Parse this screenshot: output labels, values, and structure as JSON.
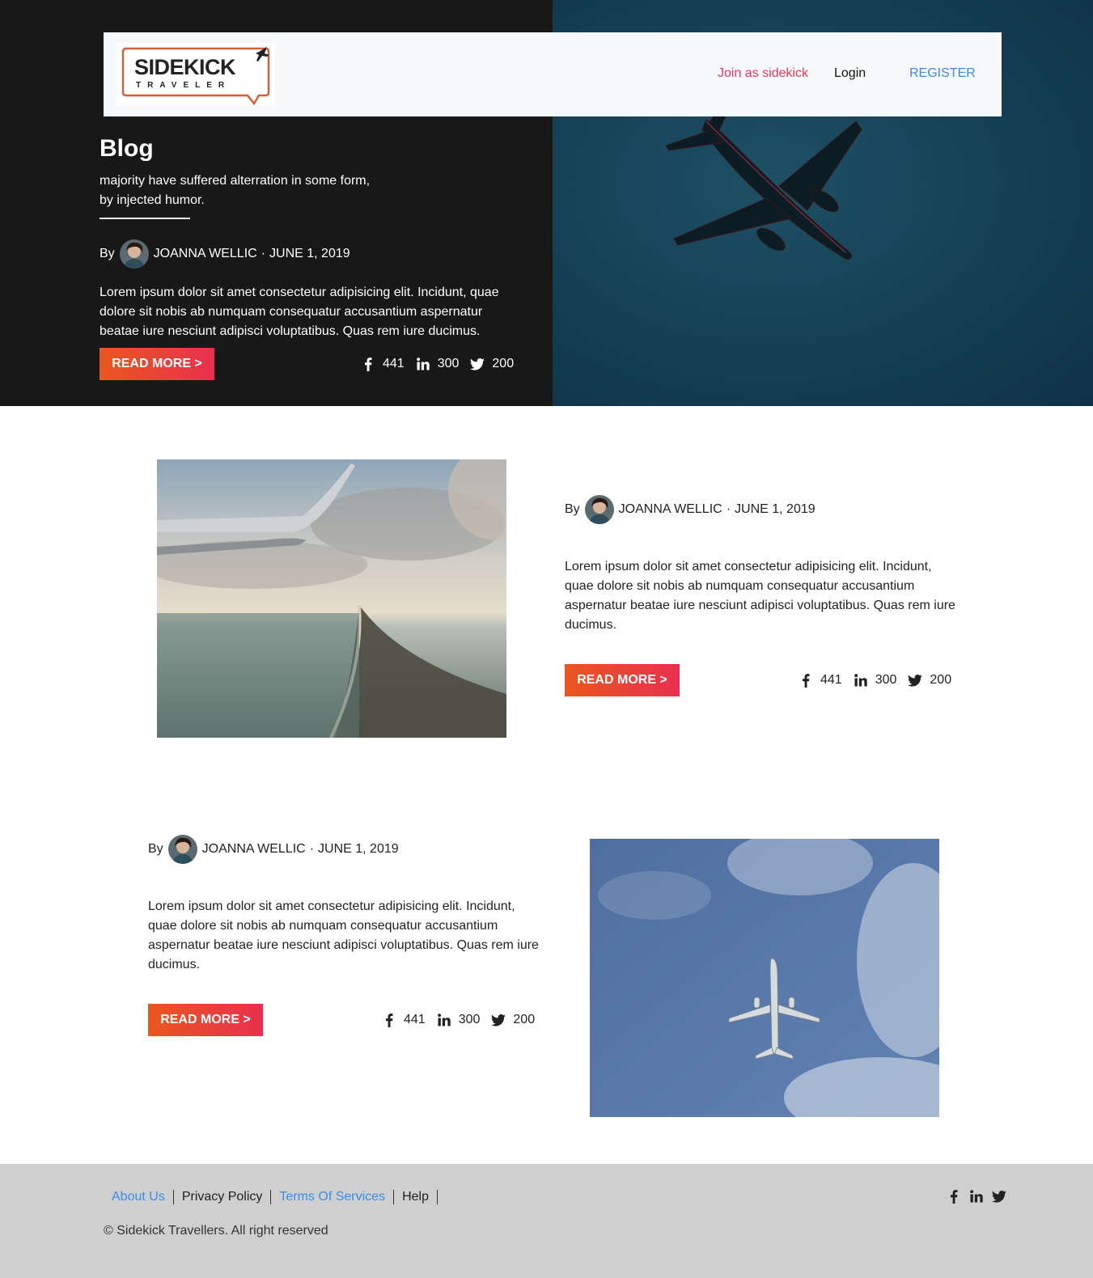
{
  "nav": {
    "logo_text": "SIDEKICK",
    "logo_sub": "TRAVELER",
    "join_label": "Join as sidekick",
    "login_label": "Login",
    "register_label": "REGISTER"
  },
  "hero": {
    "title": "Blog",
    "subtitle_line1": "majority have suffered alterration in some form,",
    "subtitle_line2": "by injected humor.",
    "by_label": "By",
    "author": "JOANNA WELLIC",
    "separator": "·",
    "date": "JUNE 1, 2019",
    "excerpt": "Lorem ipsum dolor sit amet consectetur adipisicing elit. Incidunt, quae dolore sit nobis ab numquam consequatur accusantium aspernatur beatae iure nesciunt adipisci voluptatibus. Quas rem iure ducimus.",
    "read_more": "READ MORE >",
    "facebook_count": "441",
    "linkedin_count": "300",
    "twitter_count": "200"
  },
  "posts": [
    {
      "by_label": "By",
      "author": "JOANNA WELLIC",
      "separator": "·",
      "date": "JUNE 1, 2019",
      "excerpt": "Lorem ipsum dolor sit amet consectetur adipisicing elit. Incidunt, quae dolore sit nobis ab numquam consequatur accusantium aspernatur beatae iure nesciunt adipisci voluptatibus. Quas rem iure ducimus.",
      "read_more": "READ MORE >",
      "facebook_count": "441",
      "linkedin_count": "300",
      "twitter_count": "200",
      "image": "airplane-wing-over-coast"
    },
    {
      "by_label": "By",
      "author": "JOANNA WELLIC",
      "separator": "·",
      "date": "JUNE 1, 2019",
      "excerpt": "Lorem ipsum dolor sit amet consectetur adipisicing elit. Incidunt, quae dolore sit nobis ab numquam consequatur accusantium aspernatur beatae iure nesciunt adipisci voluptatibus. Quas rem iure ducimus.",
      "read_more": "READ MORE >",
      "facebook_count": "441",
      "linkedin_count": "300",
      "twitter_count": "200",
      "image": "airplane-in-blue-sky"
    }
  ],
  "footer": {
    "links": [
      "About Us",
      "Privacy Policy",
      "Terms Of Services",
      "Help"
    ],
    "copyright": "© Sidekick Travellers. All right reserved"
  },
  "icons": [
    "facebook-icon",
    "linkedin-icon",
    "twitter-icon",
    "airplane-icon"
  ],
  "colors": {
    "accent_start": "#e9571f",
    "accent_end": "#e8304f",
    "link_pink": "#e8365f",
    "link_blue": "#3c8ce7",
    "hero_dark": "#181818",
    "footer_bg": "#cfcfcf"
  }
}
